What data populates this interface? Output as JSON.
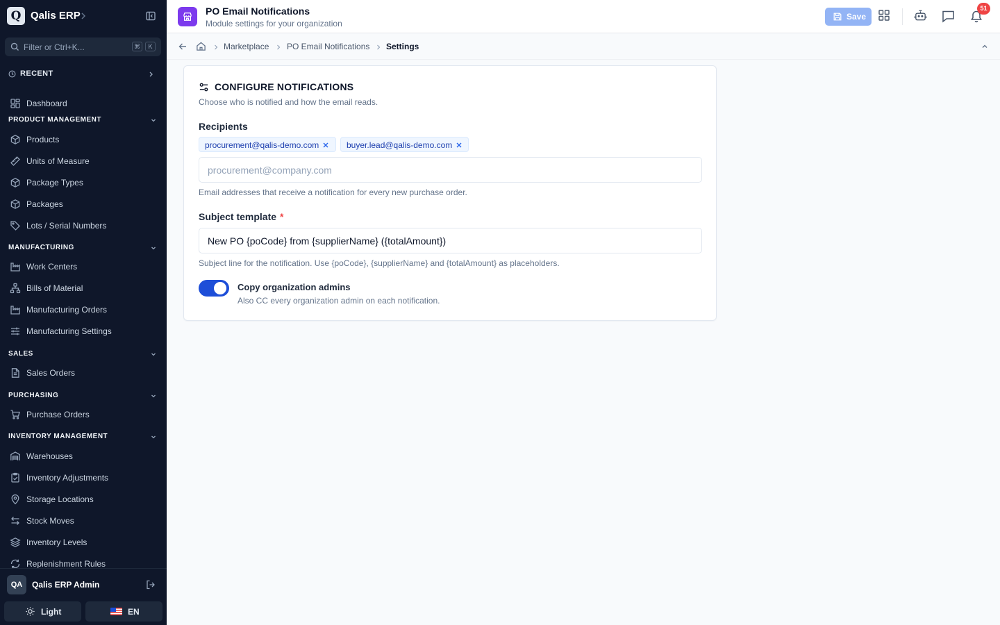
{
  "sidebar": {
    "app_name": "Qalis ERP",
    "logo_letter": "Q",
    "search_placeholder": "Filter or Ctrl+K...",
    "kbd1": "⌘",
    "kbd2": "K",
    "recent_label": "RECENT",
    "dashboard": "Dashboard",
    "sections": {
      "product": "PRODUCT MANAGEMENT",
      "manufacturing": "MANUFACTURING",
      "sales": "SALES",
      "purchasing": "PURCHASING",
      "inventory": "INVENTORY MANAGEMENT"
    },
    "items": {
      "products": "Products",
      "units": "Units of Measure",
      "package_types": "Package Types",
      "packages": "Packages",
      "lots": "Lots / Serial Numbers",
      "work_centers": "Work Centers",
      "bom": "Bills of Material",
      "mfg_orders": "Manufacturing Orders",
      "mfg_settings": "Manufacturing Settings",
      "sales_orders": "Sales Orders",
      "purchase_orders": "Purchase Orders",
      "warehouses": "Warehouses",
      "inv_adjustments": "Inventory Adjustments",
      "storage_locations": "Storage Locations",
      "stock_moves": "Stock Moves",
      "inv_levels": "Inventory Levels",
      "replenishment": "Replenishment Rules"
    },
    "user": {
      "initials": "QA",
      "name": "Qalis ERP Admin"
    },
    "theme_label": "Light",
    "lang_label": "EN"
  },
  "header": {
    "title": "PO Email Notifications",
    "subtitle": "Module settings for your organization",
    "save_label": "Save",
    "notification_count": "51"
  },
  "breadcrumb": {
    "marketplace": "Marketplace",
    "module": "PO Email Notifications",
    "current": "Settings"
  },
  "card": {
    "title": "CONFIGURE NOTIFICATIONS",
    "subtitle": "Choose who is notified and how the email reads.",
    "recipients_label": "Recipients",
    "recipients": [
      "procurement@qalis-demo.com",
      "buyer.lead@qalis-demo.com"
    ],
    "recipients_placeholder": "procurement@company.com",
    "recipients_help": "Email addresses that receive a notification for every new purchase order.",
    "subject_label": "Subject template",
    "required_mark": "*",
    "subject_value": "New PO {poCode} from {supplierName} ({totalAmount})",
    "subject_help": "Subject line for the notification. Use {poCode}, {supplierName} and {totalAmount} as placeholders.",
    "toggle_label": "Copy organization admins",
    "toggle_help": "Also CC every organization admin on each notification.",
    "toggle_on": true
  },
  "colors": {
    "sidebar_bg": "#0f172a",
    "accent": "#1d4ed8",
    "module_icon": "#7c3aed",
    "badge": "#ef4444",
    "save_disabled": "#93b4f5"
  }
}
